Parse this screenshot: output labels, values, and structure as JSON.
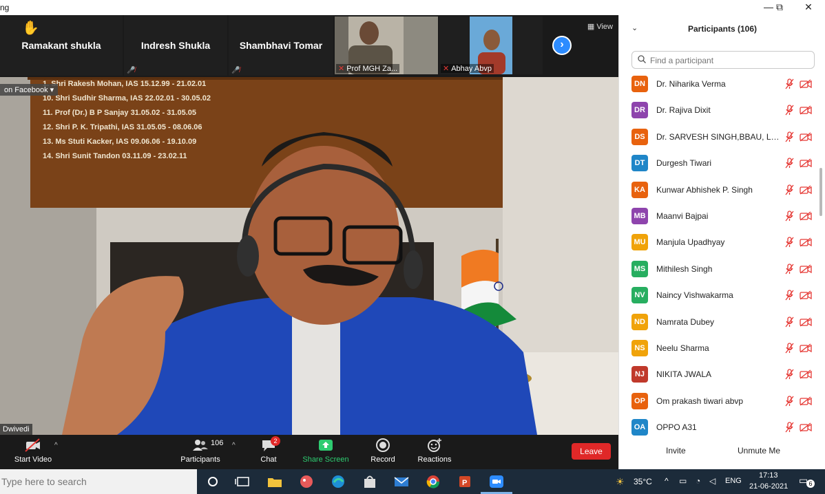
{
  "window": {
    "title_fragment": "ng",
    "minimize": "—",
    "restore": "⧉",
    "close": "✕"
  },
  "strip": {
    "tiles": [
      {
        "name": "Ramakant shukla"
      },
      {
        "name": "Indresh Shukla"
      },
      {
        "name": "Shambhavi Tomar"
      }
    ],
    "video_tiles": [
      {
        "name": "Prof MGH Za..."
      },
      {
        "name": "Abhay Abvp"
      }
    ],
    "view_label": "View"
  },
  "video": {
    "live_badge": "on Facebook",
    "speaker_name": "Dwivedi",
    "board": [
      "1. Shri Rakesh Mohan, IAS    15.12.99  -  21.02.01",
      "10. Shri Sudhir Sharma, IAS  22.02.01  -  30.05.02",
      "11. Prof (Dr.) B P Sanjay    31.05.02  -  31.05.05",
      "12. Shri P. K. Tripathi, IAS 31.05.05  -  08.06.06",
      "13. Ms Stuti Kacker, IAS     09.06.06  -  19.10.09",
      "14. Shri Sunit Tandon        03.11.09  -  23.02.11"
    ]
  },
  "toolbar": {
    "start_video": "Start Video",
    "participants": "Participants",
    "participants_count": "106",
    "chat": "Chat",
    "chat_badge": "2",
    "share_screen": "Share Screen",
    "record": "Record",
    "reactions": "Reactions",
    "leave": "Leave"
  },
  "panel": {
    "title": "Participants (106)",
    "search_placeholder": "Find a participant",
    "invite": "Invite",
    "unmute_me": "Unmute Me",
    "participants": [
      {
        "initials": "DN",
        "name": "Dr. Niharika Verma",
        "color": "#e8620e"
      },
      {
        "initials": "DR",
        "name": "Dr. Rajiva Dixit",
        "color": "#8e44ad"
      },
      {
        "initials": "DS",
        "name": "Dr. SARVESH SINGH,BBAU, LUC...",
        "color": "#e8620e"
      },
      {
        "initials": "DT",
        "name": "Durgesh Tiwari",
        "color": "#1f86c8"
      },
      {
        "initials": "KA",
        "name": "Kunwar Abhishek P. Singh",
        "color": "#e8620e"
      },
      {
        "initials": "MB",
        "name": "Maanvi Bajpai",
        "color": "#8e44ad"
      },
      {
        "initials": "MU",
        "name": "Manjula Upadhyay",
        "color": "#f0a30a"
      },
      {
        "initials": "MS",
        "name": "Mithilesh Singh",
        "color": "#27ae60"
      },
      {
        "initials": "NV",
        "name": "Naincy Vishwakarma",
        "color": "#27ae60"
      },
      {
        "initials": "ND",
        "name": "Namrata Dubey",
        "color": "#f0a30a"
      },
      {
        "initials": "NS",
        "name": "Neelu Sharma",
        "color": "#f0a30a"
      },
      {
        "initials": "NJ",
        "name": "NIKITA JWALA",
        "color": "#c0392b"
      },
      {
        "initials": "OP",
        "name": "Om prakash tiwari abvp",
        "color": "#e8620e"
      },
      {
        "initials": "OA",
        "name": "OPPO A31",
        "color": "#1f86c8"
      }
    ]
  },
  "taskbar": {
    "search_placeholder": "Type here to search",
    "temperature": "35°C",
    "language": "ENG",
    "time": "17:13",
    "date": "21-06-2021",
    "notification_count": "6"
  },
  "colors": {
    "accent": "#2d8cff",
    "leave": "#e02828",
    "share": "#2ecc71",
    "muted": "#e53935"
  }
}
